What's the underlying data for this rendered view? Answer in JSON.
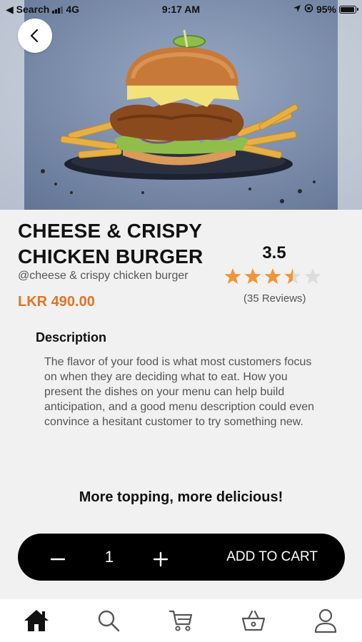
{
  "status_bar": {
    "back_app": "◀ Search",
    "network": "4G",
    "time": "9:17 AM",
    "battery": "95%"
  },
  "product": {
    "title": "CHEESE & CRISPY CHICKEN BURGER",
    "handle": "@cheese & crispy chicken burger",
    "price": "LKR 490.00",
    "rating": "3.5",
    "rating_value": 3.5,
    "rating_max": 5,
    "reviews": "(35 Reviews)"
  },
  "description": {
    "heading": "Description",
    "body": "The flavor of your food is what most customers focus on when they are deciding what to eat. How you present the dishes on your menu can help build anticipation, and a good menu description could even convince a hesitant customer to try something new."
  },
  "toppings": {
    "heading": "More topping, more delicious!"
  },
  "cart": {
    "quantity": "1",
    "add_label": "ADD TO CART"
  },
  "colors": {
    "accent": "#e0742a",
    "star": "#f0963a",
    "star_empty": "#dcdcdc",
    "cart_bar": "#000000"
  },
  "nav": {
    "items": [
      "home-icon",
      "search-icon",
      "cart-icon",
      "basket-icon",
      "profile-icon"
    ],
    "active": "home-icon"
  }
}
